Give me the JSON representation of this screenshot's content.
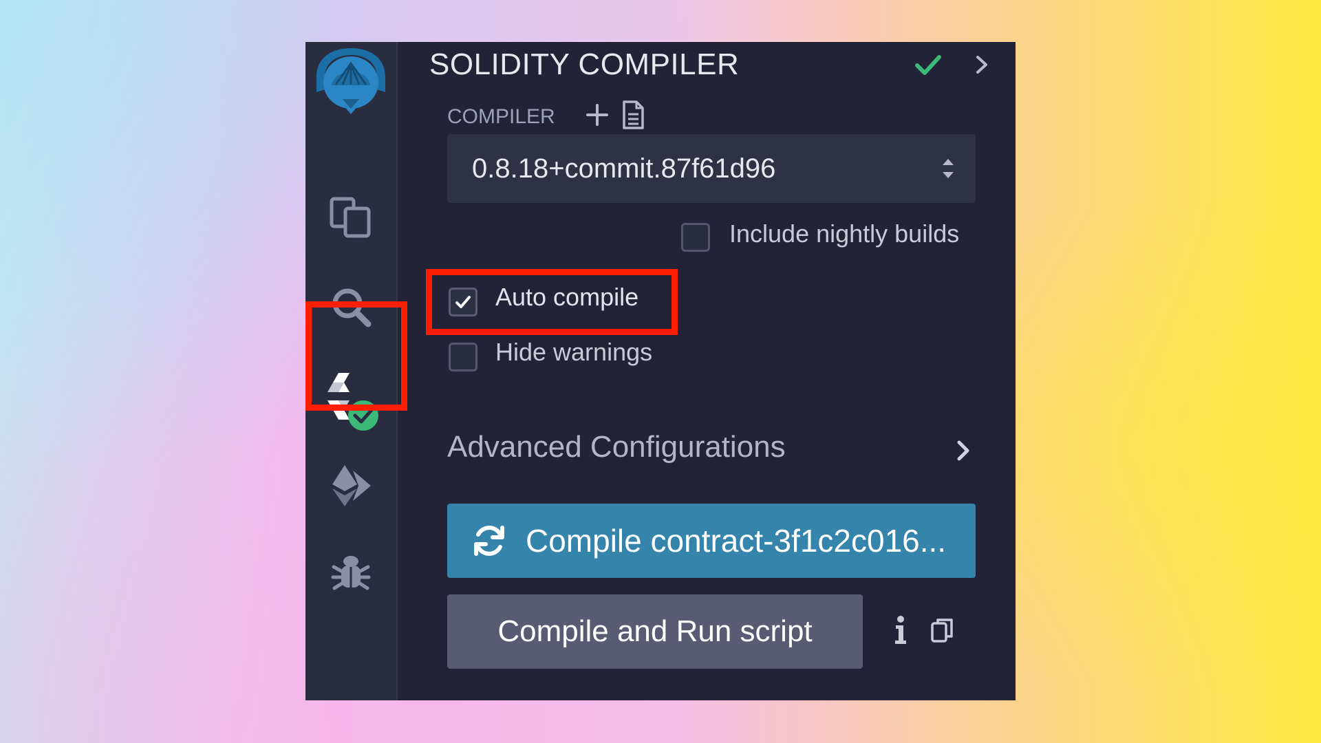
{
  "panel": {
    "title": "SOLIDITY COMPILER"
  },
  "compiler": {
    "label": "COMPILER",
    "selected_version": "0.8.18+commit.87f61d96"
  },
  "options": {
    "include_nightly_label": "Include nightly builds",
    "include_nightly_checked": false,
    "auto_compile_label": "Auto compile",
    "auto_compile_checked": true,
    "hide_warnings_label": "Hide warnings",
    "hide_warnings_checked": false
  },
  "advanced": {
    "label": "Advanced Configurations"
  },
  "buttons": {
    "compile_label": "Compile contract-3f1c2c016...",
    "run_script_label": "Compile and Run script"
  },
  "sidebar": {
    "items": [
      {
        "icon": "remix-logo-icon"
      },
      {
        "icon": "file-explorer-icon"
      },
      {
        "icon": "search-icon"
      },
      {
        "icon": "solidity-compiler-icon",
        "active": true
      },
      {
        "icon": "deploy-run-icon"
      },
      {
        "icon": "debugger-icon"
      }
    ]
  },
  "colors": {
    "highlight": "#ff1f00",
    "compile_button": "#3484ab",
    "success_check": "#3cb878",
    "panel_background": "#222336",
    "sidebar_background": "#2a2c3f"
  }
}
